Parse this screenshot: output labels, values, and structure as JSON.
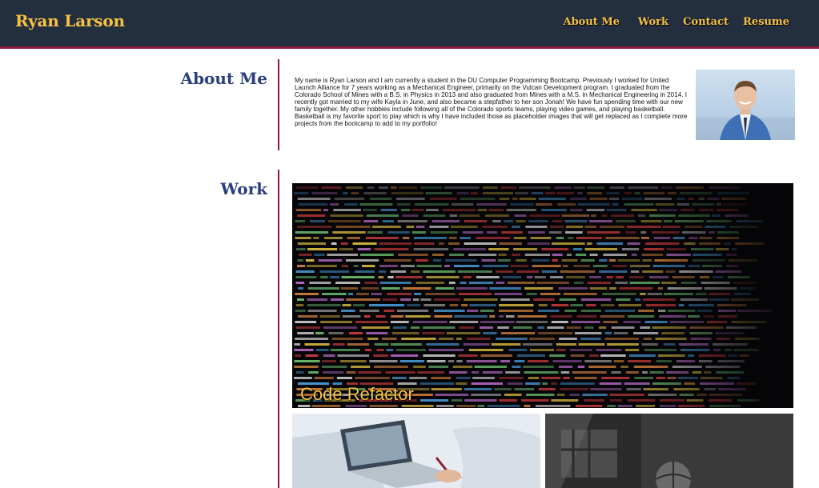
{
  "header": {
    "brand": "Ryan Larson",
    "nav": [
      {
        "label": "About Me"
      },
      {
        "label": "Work"
      },
      {
        "label": "Contact"
      },
      {
        "label": "Resume"
      }
    ]
  },
  "about": {
    "title": "About Me",
    "bio": "My name is Ryan Larson and I am currently a student in the DU Computer Programming Bootcamp. Previously I worked for United Launch Alliance for 7 years working as a Mechanical Engineer, primarily on the Vulcan Development program. I graduated from the Colorado School of Mines with a B.S. in Physics in 2013 and also graduated from Mines with a M.S. in Mechanical Engineering in 2014. I recently got married to my wife Kayla in June, and also became a stepfather to her son Jonah! We have fun spending time with our new family together. My other hobbies include following all of the Colorado sports teams, playing video games, and playing basketball. Basketball is my favorite sport to play which is why I have included those as placeholder images that will get replaced as I complete more projects from the bootcamp to add to my portfolio!"
  },
  "work": {
    "title": "Work",
    "featured_label": "Code Refactor"
  },
  "colors": {
    "header_bg": "#232e3f",
    "accent_gold": "#f6c244",
    "accent_maroon": "#8e1d3b",
    "heading_navy": "#2a3f7c"
  }
}
